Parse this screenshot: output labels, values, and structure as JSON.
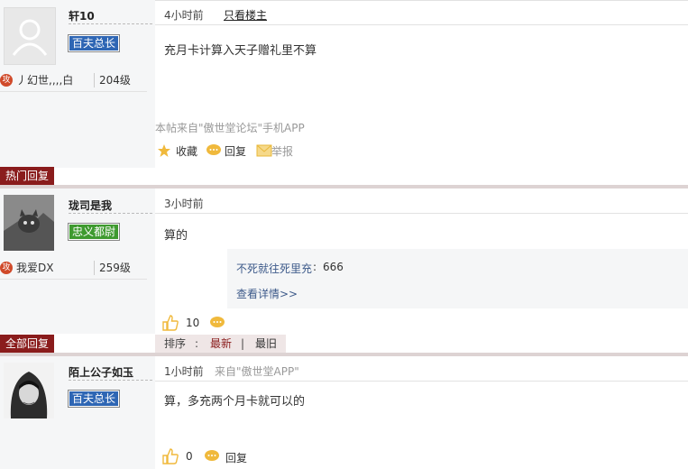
{
  "post1": {
    "username": "轩10",
    "rank": "百夫总长",
    "guild_icon": "攻",
    "guild": "丿幻世,,,,白",
    "level": "204级",
    "time": "4小时前",
    "only_op_link": "只看楼主",
    "content": "充月卡计算入天子赠礼里不算",
    "source": "本帖来自\"傲世堂论坛\"手机APP",
    "actions": {
      "favorite": "收藏",
      "reply": "回复",
      "report": "举报"
    }
  },
  "hot_section": "热门回复",
  "post2": {
    "username": "珑司是我",
    "rank": "忠义都尉",
    "guild_icon": "攻",
    "guild": "我爱DX",
    "level": "259级",
    "time": "3小时前",
    "content": "算的",
    "quote": {
      "author": "不死就往死里充",
      "colon": ":",
      "text": "666",
      "more": "查看详情>>"
    },
    "likes": "10"
  },
  "all_section": "全部回复",
  "sort": {
    "label": "排序",
    "colon": ":",
    "newest": "最新",
    "divider": "|",
    "oldest": "最旧"
  },
  "post3": {
    "username": "陌上公子如玉",
    "rank": "百夫总长",
    "time": "1小时前",
    "source": "来自\"傲世堂APP\"",
    "content": "算，多充两个月卡就可以的",
    "likes": "0",
    "reply": "回复"
  },
  "colors": {
    "section_tag": "#8a1c1c",
    "rank_blue": "#2e66b4",
    "rank_green": "#3e9a2f",
    "like_icon": "#f0b93c"
  }
}
